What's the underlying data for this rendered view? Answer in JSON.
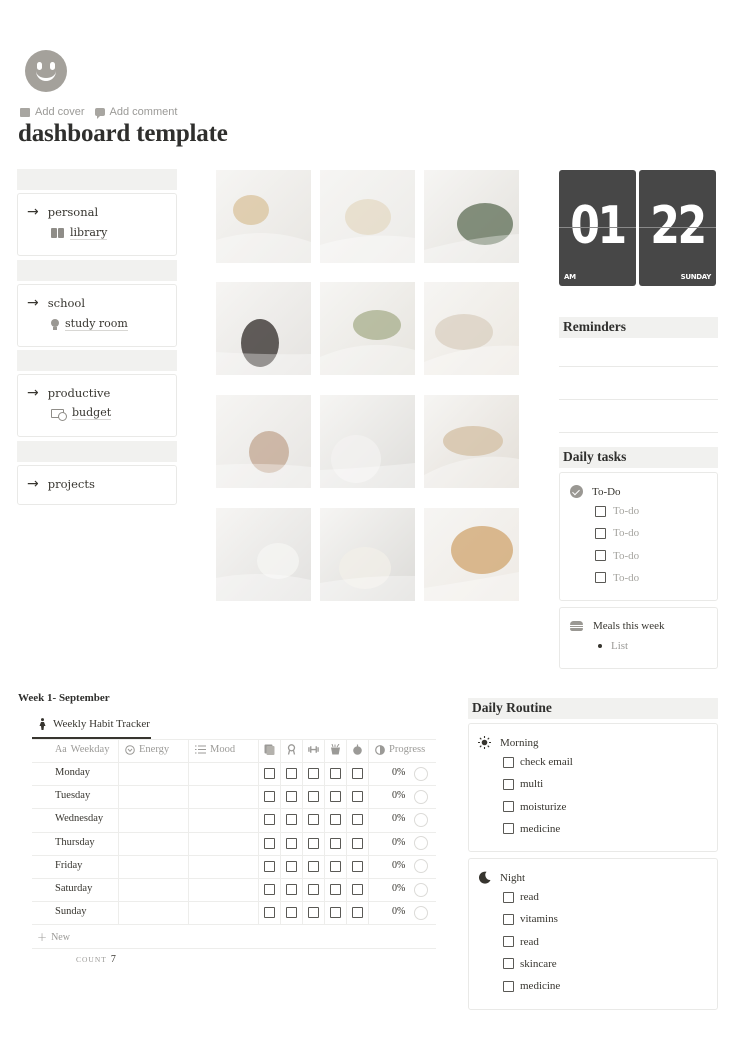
{
  "page": {
    "icon": "smiley-face-icon",
    "actions": [
      {
        "icon": "image-icon",
        "label": "Add cover"
      },
      {
        "icon": "comment-icon",
        "label": "Add comment"
      }
    ],
    "title": "dashboard template"
  },
  "nav": {
    "cards": [
      {
        "label": "personal",
        "sub": {
          "icon": "book-icon",
          "label": "library"
        }
      },
      {
        "label": "school",
        "sub": {
          "icon": "lightbulb-icon",
          "label": "study room"
        }
      },
      {
        "label": "productive",
        "sub": {
          "icon": "money-icon",
          "label": "budget"
        }
      },
      {
        "label": "projects"
      }
    ]
  },
  "gallery": {
    "photos": [
      {
        "name": "pancakes-plate",
        "colors": [
          "#e8e6e2",
          "#d9c39c"
        ]
      },
      {
        "name": "tote-bag-flowers",
        "colors": [
          "#ecebe8",
          "#e4d9c4"
        ]
      },
      {
        "name": "plant-curtain",
        "colors": [
          "#e3e1dc",
          "#5e6e56"
        ]
      },
      {
        "name": "candle-bed",
        "colors": [
          "#e5e3e0",
          "#2f2a27"
        ]
      },
      {
        "name": "matcha-latte",
        "colors": [
          "#e6e4de",
          "#a7ad8b"
        ]
      },
      {
        "name": "book-on-sheets",
        "colors": [
          "#ece8e1",
          "#d9cfc0"
        ]
      },
      {
        "name": "candle-lavender",
        "colors": [
          "#e7e5e2",
          "#c2a590"
        ]
      },
      {
        "name": "white-pillows",
        "colors": [
          "#dfdedb",
          "#f3f2f0"
        ]
      },
      {
        "name": "coffee-cup-shelf",
        "colors": [
          "#e3ded7",
          "#d3bfa3"
        ]
      },
      {
        "name": "dior-books",
        "colors": [
          "#e2e1df",
          "#f6f5f3"
        ]
      },
      {
        "name": "white-flowers",
        "colors": [
          "#dcdbd8",
          "#f2efe8"
        ]
      },
      {
        "name": "apple-toast-candle",
        "colors": [
          "#eeeae4",
          "#d0a46e"
        ]
      }
    ]
  },
  "clock": {
    "hour": "01",
    "minute": "22",
    "period": "AM",
    "day": "SUNDAY"
  },
  "reminders": {
    "title": "Reminders"
  },
  "daily_tasks": {
    "title": "Daily tasks",
    "todo": {
      "icon": "check-circle-icon",
      "label": "To-Do",
      "items": [
        "To-do",
        "To-do",
        "To-do",
        "To-do"
      ]
    },
    "meals": {
      "icon": "burger-icon",
      "label": "Meals this week",
      "items": [
        "List"
      ]
    }
  },
  "habit_tracker": {
    "section_title": "Week 1- September",
    "tab": {
      "icon": "person-walking-icon",
      "label": "Weekly Habit Tracker"
    },
    "columns": [
      {
        "icon": "text-aa-icon",
        "label": "Weekday"
      },
      {
        "icon": "select-circle-icon",
        "label": "Energy"
      },
      {
        "icon": "list-icon",
        "label": "Mood"
      },
      {
        "icon": "book-stack-icon",
        "label": ""
      },
      {
        "icon": "medal-icon",
        "label": ""
      },
      {
        "icon": "dumbbell-icon",
        "label": ""
      },
      {
        "icon": "drink-cup-icon",
        "label": ""
      },
      {
        "icon": "apple-icon",
        "label": ""
      },
      {
        "icon": "half-circle-icon",
        "label": "Progress"
      }
    ],
    "rows": [
      {
        "day": "Monday",
        "energy": "",
        "mood": "",
        "checks": [
          false,
          false,
          false,
          false,
          false
        ],
        "progress": "0%"
      },
      {
        "day": "Tuesday",
        "energy": "",
        "mood": "",
        "checks": [
          false,
          false,
          false,
          false,
          false
        ],
        "progress": "0%"
      },
      {
        "day": "Wednesday",
        "energy": "",
        "mood": "",
        "checks": [
          false,
          false,
          false,
          false,
          false
        ],
        "progress": "0%"
      },
      {
        "day": "Thursday",
        "energy": "",
        "mood": "",
        "checks": [
          false,
          false,
          false,
          false,
          false
        ],
        "progress": "0%"
      },
      {
        "day": "Friday",
        "energy": "",
        "mood": "",
        "checks": [
          false,
          false,
          false,
          false,
          false
        ],
        "progress": "0%"
      },
      {
        "day": "Saturday",
        "energy": "",
        "mood": "",
        "checks": [
          false,
          false,
          false,
          false,
          false
        ],
        "progress": "0%"
      },
      {
        "day": "Sunday",
        "energy": "",
        "mood": "",
        "checks": [
          false,
          false,
          false,
          false,
          false
        ],
        "progress": "0%"
      }
    ],
    "new_label": "New",
    "count_label": "COUNT",
    "count_value": "7"
  },
  "daily_routine": {
    "title": "Daily Routine",
    "morning": {
      "icon": "sun-icon",
      "label": "Morning",
      "items": [
        "check email",
        "multi",
        "moisturize",
        "medicine"
      ]
    },
    "night": {
      "icon": "moon-icon",
      "label": "Night",
      "items": [
        "read",
        "vitamins",
        "read",
        "skincare",
        "medicine"
      ]
    }
  }
}
